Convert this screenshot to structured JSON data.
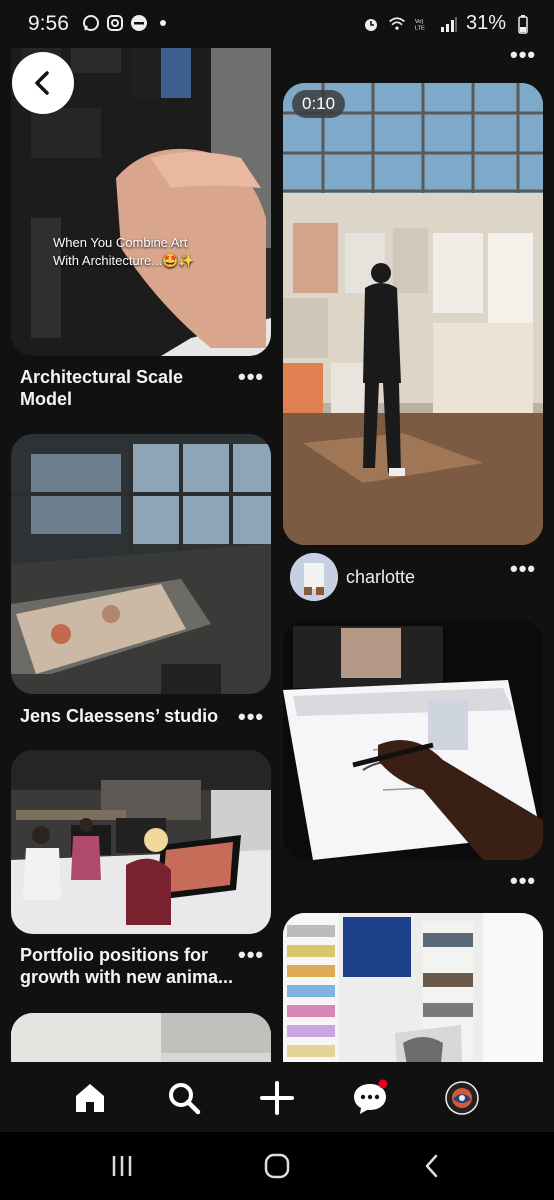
{
  "status_bar": {
    "time": "9:56",
    "battery": "31%",
    "left_icons": [
      "whatsapp-icon",
      "instagram-icon",
      "dnd-icon",
      "dot-icon"
    ],
    "right_icons": [
      "alarm-icon",
      "wifi-icon",
      "volte-icon",
      "signal-icon",
      "battery-icon"
    ]
  },
  "pins": {
    "pin1": {
      "overlay_text_line1": "When You Combine Art",
      "overlay_text_line2": "With Architecture...🤩✨",
      "title_line1": "Architectural Scale",
      "title_line2": "Model"
    },
    "pin2": {
      "video_duration": "0:10",
      "username": "charlotte"
    },
    "pin3": {
      "title": "Jens Claessens’ studio"
    },
    "pin5": {
      "title_line1": "Portfolio positions for",
      "title_line2": "growth with new anima..."
    }
  },
  "more_label": "•••",
  "bottom_nav": {
    "items": [
      "home-icon",
      "search-icon",
      "add-icon",
      "messages-icon",
      "profile-avatar"
    ]
  },
  "colors": {
    "background": "#111111",
    "notification_dot": "#e60023",
    "text": "#f4f4f4"
  }
}
